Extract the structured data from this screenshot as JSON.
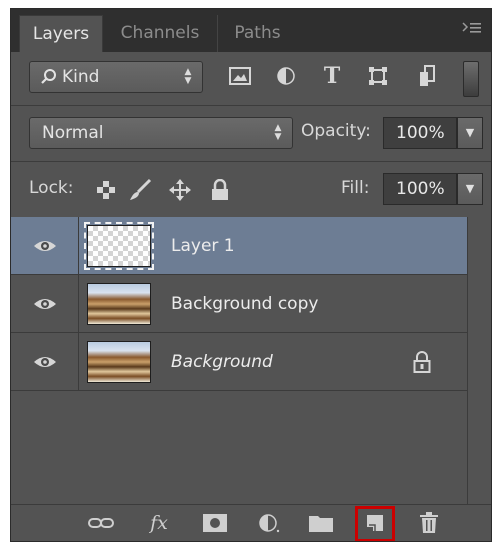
{
  "tabs": [
    {
      "label": "Layers",
      "active": true
    },
    {
      "label": "Channels",
      "active": false
    },
    {
      "label": "Paths",
      "active": false
    }
  ],
  "filter": {
    "kind_label": "Kind",
    "icons": [
      "image-filter-icon",
      "adjustment-filter-icon",
      "type-filter-icon",
      "shape-filter-icon",
      "smart-object-filter-icon"
    ],
    "type_glyph": "T"
  },
  "blend": {
    "mode": "Normal",
    "opacity_label": "Opacity:",
    "opacity_value": "100%"
  },
  "lock": {
    "label": "Lock:",
    "fill_label": "Fill:",
    "fill_value": "100%"
  },
  "layers": [
    {
      "name": "Layer 1",
      "selected": true,
      "italic": false,
      "locked": false,
      "thumb": "transparent"
    },
    {
      "name": "Background copy",
      "selected": false,
      "italic": false,
      "locked": false,
      "thumb": "photo"
    },
    {
      "name": "Background",
      "selected": false,
      "italic": true,
      "locked": true,
      "thumb": "photo"
    }
  ],
  "bottom_icons": [
    "link-layers-icon",
    "fx-icon",
    "add-mask-icon",
    "adjustment-layer-icon",
    "new-group-icon",
    "new-layer-icon",
    "delete-layer-icon"
  ],
  "fx_glyph": "fx",
  "colors": {
    "panel_bg": "#535353",
    "selected_row": "#6d7d94",
    "highlight": "#cc0000"
  }
}
